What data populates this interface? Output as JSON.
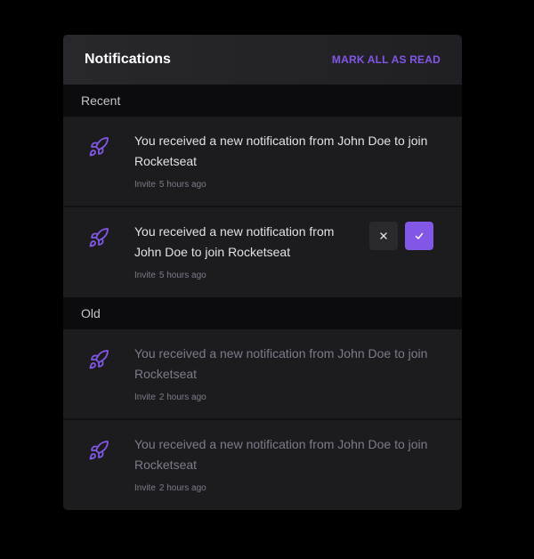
{
  "header": {
    "title": "Notifications",
    "mark_all_label": "MARK ALL AS READ"
  },
  "sections": [
    {
      "label": "Recent",
      "items": [
        {
          "text": "You received a new notification from John Doe to join Rocketseat",
          "type": "Invite",
          "time": "5 hours ago",
          "icon": "rocket-icon",
          "read": false
        },
        {
          "text": "You received a new notification from John Doe to join Rocketseat",
          "type": "Invite",
          "time": "5 hours ago",
          "icon": "rocket-icon",
          "read": false,
          "actions": [
            "decline",
            "accept"
          ]
        }
      ]
    },
    {
      "label": "Old",
      "items": [
        {
          "text": "You received a new notification from John Doe to join Rocketseat",
          "type": "Invite",
          "time": "2 hours ago",
          "icon": "rocket-icon",
          "read": true
        },
        {
          "text": "You received a new notification from John Doe to join Rocketseat",
          "type": "Invite",
          "time": "2 hours ago",
          "icon": "rocket-icon",
          "read": true
        }
      ]
    }
  ],
  "colors": {
    "accent": "#8257e5",
    "background": "#000000",
    "panel": "#202024",
    "item": "#1c1c1f",
    "section": "#0c0c0e"
  }
}
